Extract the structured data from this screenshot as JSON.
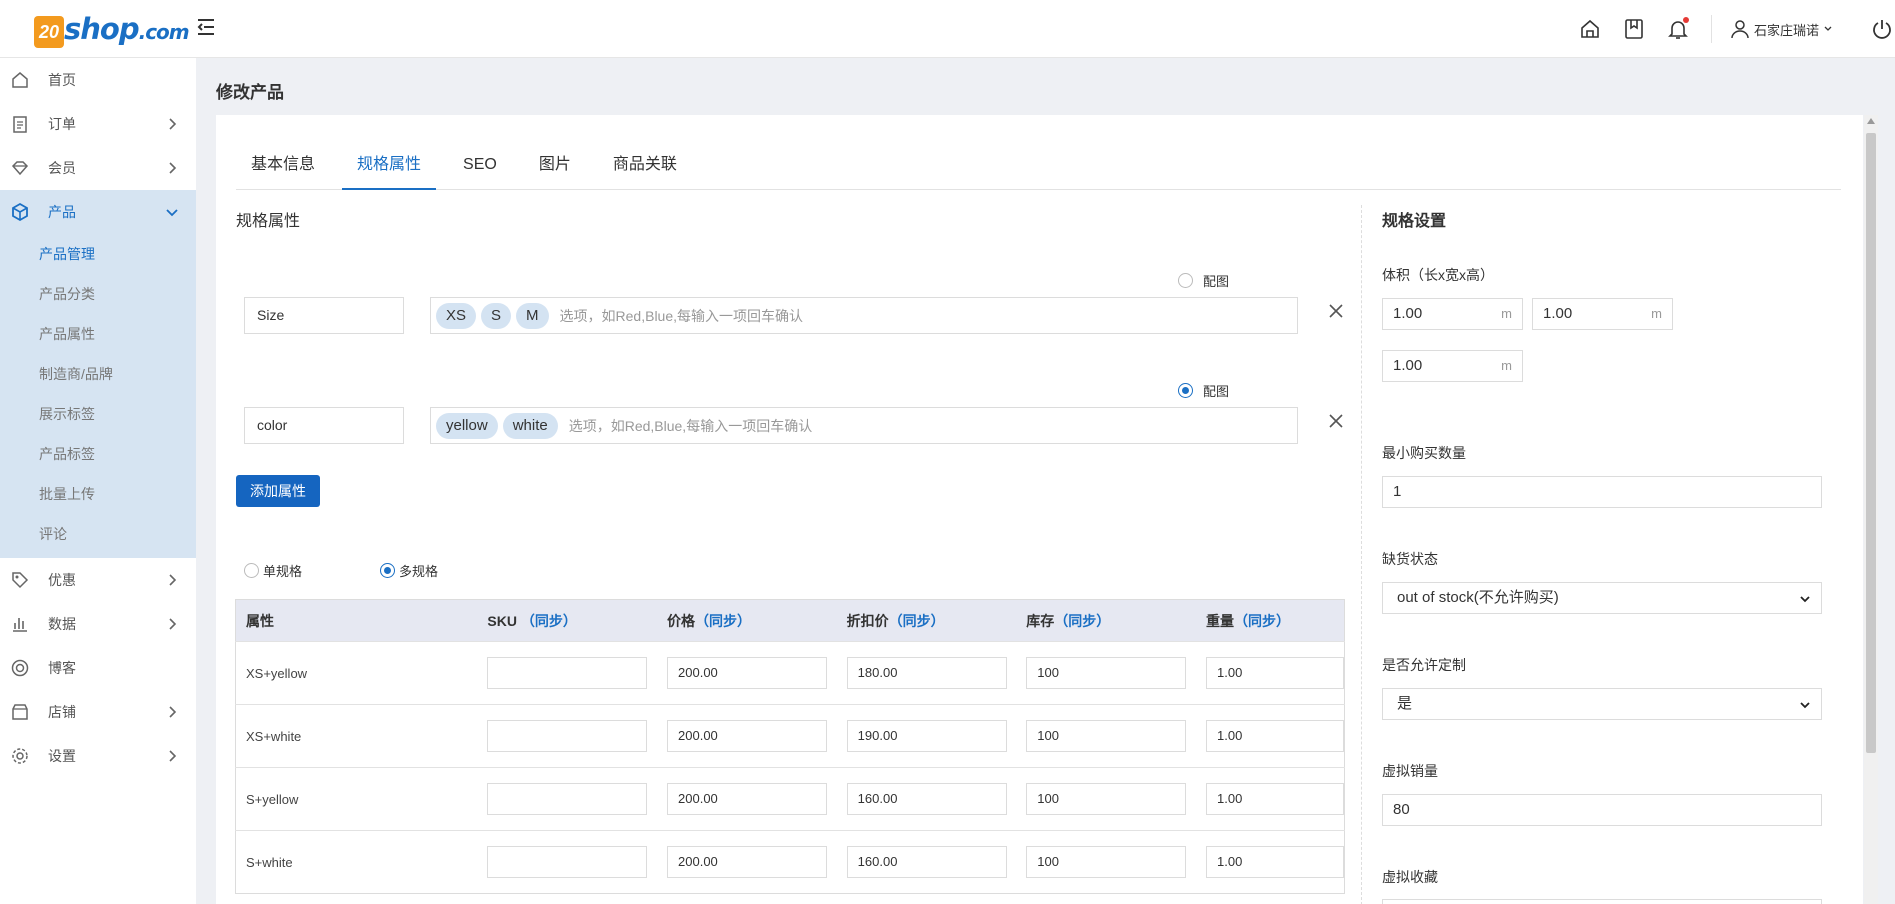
{
  "brand": {
    "logo_prefix": "20",
    "logo_main": "shop",
    "logo_suffix": ".com"
  },
  "header": {
    "user_name": "石家庄瑞诺"
  },
  "sidebar": {
    "items": [
      {
        "label": "首页"
      },
      {
        "label": "订单"
      },
      {
        "label": "会员"
      },
      {
        "label": "产品"
      },
      {
        "label": "优惠"
      },
      {
        "label": "数据"
      },
      {
        "label": "博客"
      },
      {
        "label": "店铺"
      },
      {
        "label": "设置"
      }
    ],
    "product_submenu": [
      "产品管理",
      "产品分类",
      "产品属性",
      "制造商/品牌",
      "展示标签",
      "产品标签",
      "批量上传",
      "评论"
    ]
  },
  "page": {
    "title": "修改产品"
  },
  "tabs": [
    "基本信息",
    "规格属性",
    "SEO",
    "图片",
    "商品关联"
  ],
  "spec": {
    "section_title": "规格属性",
    "attributes": [
      {
        "name": "Size",
        "values": [
          "XS",
          "S",
          "M"
        ],
        "placeholder": "选项，如Red,Blue,每输入一项回车确认",
        "picture_label": "配图",
        "picture_on": false
      },
      {
        "name": "color",
        "values": [
          "yellow",
          "white"
        ],
        "placeholder": "选项，如Red,Blue,每输入一项回车确认",
        "picture_label": "配图",
        "picture_on": true
      }
    ],
    "add_button": "添加属性",
    "mode_single": "单规格",
    "mode_multi": "多规格"
  },
  "table": {
    "headers": [
      {
        "label": "属性",
        "sync": ""
      },
      {
        "label": "SKU",
        "sync": "（同步）"
      },
      {
        "label": "价格",
        "sync": "（同步）"
      },
      {
        "label": "折扣价",
        "sync": "（同步）"
      },
      {
        "label": "库存",
        "sync": "（同步）"
      },
      {
        "label": "重量",
        "sync": "（同步）"
      }
    ],
    "rows": [
      {
        "attr": "XS+yellow",
        "sku": "",
        "price": "200.00",
        "discount": "180.00",
        "stock": "100",
        "weight": "1.00"
      },
      {
        "attr": "XS+white",
        "sku": "",
        "price": "200.00",
        "discount": "190.00",
        "stock": "100",
        "weight": "1.00"
      },
      {
        "attr": "S+yellow",
        "sku": "",
        "price": "200.00",
        "discount": "160.00",
        "stock": "100",
        "weight": "1.00"
      },
      {
        "attr": "S+white",
        "sku": "",
        "price": "200.00",
        "discount": "160.00",
        "stock": "100",
        "weight": "1.00"
      }
    ]
  },
  "settings": {
    "title": "规格设置",
    "volume_label": "体积（长x宽x高）",
    "volume": [
      "1.00",
      "1.00",
      "1.00"
    ],
    "unit": "m",
    "min_qty_label": "最小购买数量",
    "min_qty": "1",
    "stock_status_label": "缺货状态",
    "stock_status": "out of stock(不允许购买)",
    "custom_label": "是否允许定制",
    "custom": "是",
    "virtual_sales_label": "虚拟销量",
    "virtual_sales": "80",
    "virtual_fav_label": "虚拟收藏"
  },
  "colors": {
    "accent": "#1a6fc4",
    "sidebar_active_bg": "#d6e4f2",
    "button_bg": "#1565c0",
    "tag_bg": "#d4e3f2"
  }
}
